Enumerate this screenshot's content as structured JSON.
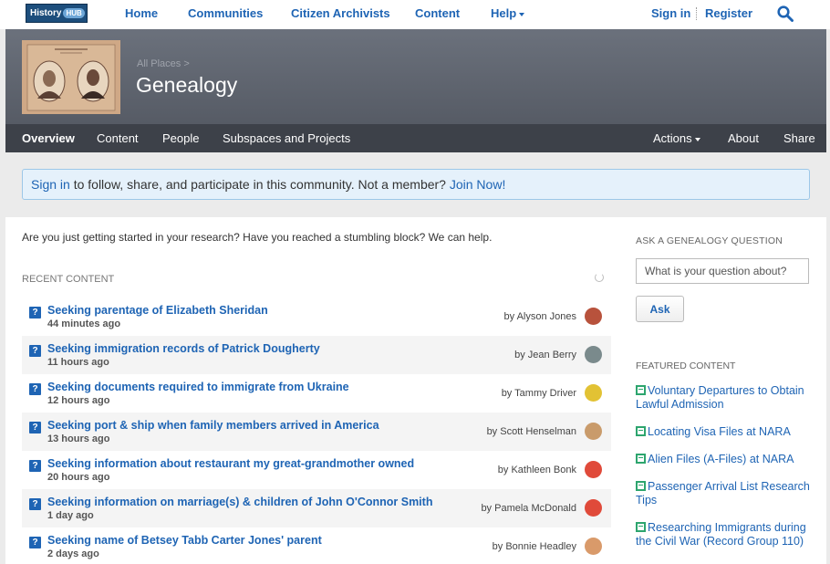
{
  "topnav": {
    "logo_text": "History",
    "logo_hub": "HUB",
    "links": [
      "Home",
      "Communities",
      "Citizen Archivists",
      "Content",
      "Help"
    ],
    "signin": "Sign in",
    "register": "Register"
  },
  "banner": {
    "breadcrumb": "All Places >",
    "title": "Genealogy"
  },
  "subnav": {
    "items": [
      "Overview",
      "Content",
      "People",
      "Subspaces and Projects"
    ],
    "right_items": [
      "Actions",
      "About",
      "Share"
    ]
  },
  "signbar": {
    "signin": "Sign in",
    "text": " to follow, share, and participate in this community. Not a member? ",
    "join": "Join Now!"
  },
  "main": {
    "intro": "Are you just getting started in your research? Have you reached a stumbling block? We can help.",
    "recent_title": "RECENT CONTENT",
    "items": [
      {
        "title": "Seeking parentage of Elizabeth Sheridan",
        "time": "44 minutes ago",
        "author": "by Alyson Jones",
        "avatar_color": "#b8523c"
      },
      {
        "title": "Seeking immigration records of Patrick Dougherty",
        "time": "11 hours ago",
        "author": "by Jean Berry",
        "avatar_color": "#7a8a8c"
      },
      {
        "title": "Seeking documents required to immigrate from Ukraine",
        "time": "12 hours ago",
        "author": "by Tammy Driver",
        "avatar_color": "#e2c234"
      },
      {
        "title": "Seeking port & ship when family members arrived in America",
        "time": "13 hours ago",
        "author": "by Scott Henselman",
        "avatar_color": "#c99b6b"
      },
      {
        "title": "Seeking information about restaurant my great-grandmother owned",
        "time": "20 hours ago",
        "author": "by Kathleen Bonk",
        "avatar_color": "#e04a3a"
      },
      {
        "title": "Seeking information on marriage(s) & children of John O'Connor Smith",
        "time": "1 day ago",
        "author": "by Pamela McDonald",
        "avatar_color": "#e04a3a"
      },
      {
        "title": "Seeking name of Betsey Tabb Carter Jones' parent",
        "time": "2 days ago",
        "author": "by Bonnie Headley",
        "avatar_color": "#d99a6a"
      }
    ]
  },
  "sidebar": {
    "ask_title": "ASK A GENEALOGY QUESTION",
    "ask_placeholder": "What is your question about?",
    "ask_button": "Ask",
    "featured_title": "FEATURED CONTENT",
    "featured": [
      "Voluntary Departures to Obtain Lawful Admission",
      "Locating Visa Files at NARA",
      "Alien Files (A-Files) at NARA",
      "Passenger Arrival List Research Tips",
      "Researching Immigrants during the Civil War (Record Group 110)"
    ]
  },
  "colors": {
    "link": "#1e64b4",
    "banner": "#61666f",
    "subnav": "#3d4149",
    "featured_icon": "#2da56e"
  }
}
